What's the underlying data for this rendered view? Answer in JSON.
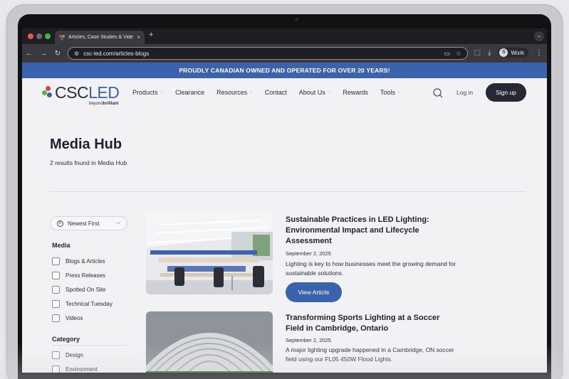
{
  "browser": {
    "tab_title": "Articles, Case Studies & Vide",
    "tab_close": "×",
    "new_tab": "+",
    "url": "csc-led.com/articles-blogs",
    "profile_initial": "S",
    "profile_name": "Work"
  },
  "site": {
    "banner": "PROUDLY CANADIAN OWNED AND OPERATED FOR OVER 20 YEARS!",
    "logo_csc": "CSC",
    "logo_led": "LED",
    "logo_tag_a": "beyond",
    "logo_tag_b": "brilliant",
    "brand_colors": {
      "blue": "#3a63ad",
      "dark": "#262833",
      "red": "#e0403a",
      "green": "#5fb04a"
    },
    "nav": {
      "products": "Products",
      "clearance": "Clearance",
      "resources": "Resources",
      "contact": "Contact",
      "about": "About Us",
      "rewards": "Rewards",
      "tools": "Tools"
    },
    "login": "Log in",
    "signup": "Sign up"
  },
  "hub": {
    "title": "Media Hub",
    "results": "2 results found in Media Hub",
    "sort_label": "Newest First",
    "media_heading": "Media",
    "media_options": [
      "Blogs & Articles",
      "Press Releases",
      "Spotted On Site",
      "Technical Tuesday",
      "Videos"
    ],
    "category_heading": "Category",
    "category_options": [
      "Design",
      "Environment"
    ]
  },
  "articles": [
    {
      "title": "Sustainable Practices in LED Lighting: Environmental Impact and Lifecycle Assessment",
      "date": "September 2, 2025",
      "excerpt": "Lighting is key to how businesses meet the growing demand for sustainable solutions.",
      "button": "View Article"
    },
    {
      "title": "Transforming Sports Lighting at a Soccer Field in Cambridge, Ontario",
      "date": "September 2, 2025",
      "excerpt": "A major lighting upgrade happened in a Cambridge, ON soccer field using our FL05 450W Flood Lights."
    }
  ]
}
